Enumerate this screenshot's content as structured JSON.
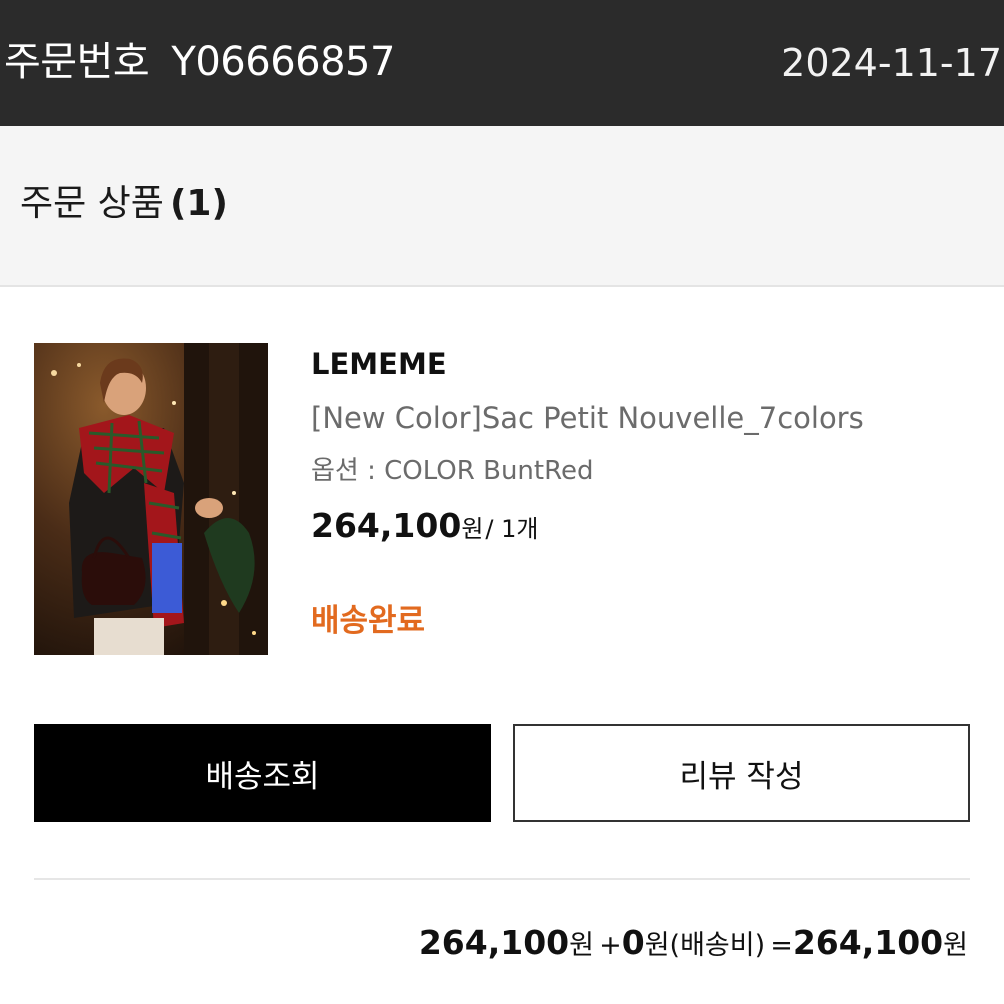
{
  "header": {
    "order_label": "주문번호",
    "order_number": "Y06666857",
    "order_date": "2024-11-17"
  },
  "section": {
    "title": "주문 상품",
    "count": "(1)"
  },
  "product": {
    "brand": "LEMEME",
    "name": "[New Color]Sac Petit Nouvelle_7colors",
    "option": "옵션 : COLOR BuntRed",
    "price": "264,100",
    "price_unit": "원",
    "quantity": "/ 1개",
    "status": "배송완료",
    "status_color": "#e26a1f"
  },
  "buttons": {
    "track": "배송조회",
    "review": "리뷰 작성"
  },
  "total": {
    "product_amount": "264,100",
    "won1": "원",
    "shipping_plus": "+",
    "shipping_amount": "0",
    "won2": "원",
    "shipping_label": "(배송비)",
    "equals": "=",
    "final_amount": "264,100",
    "won3": "원"
  }
}
